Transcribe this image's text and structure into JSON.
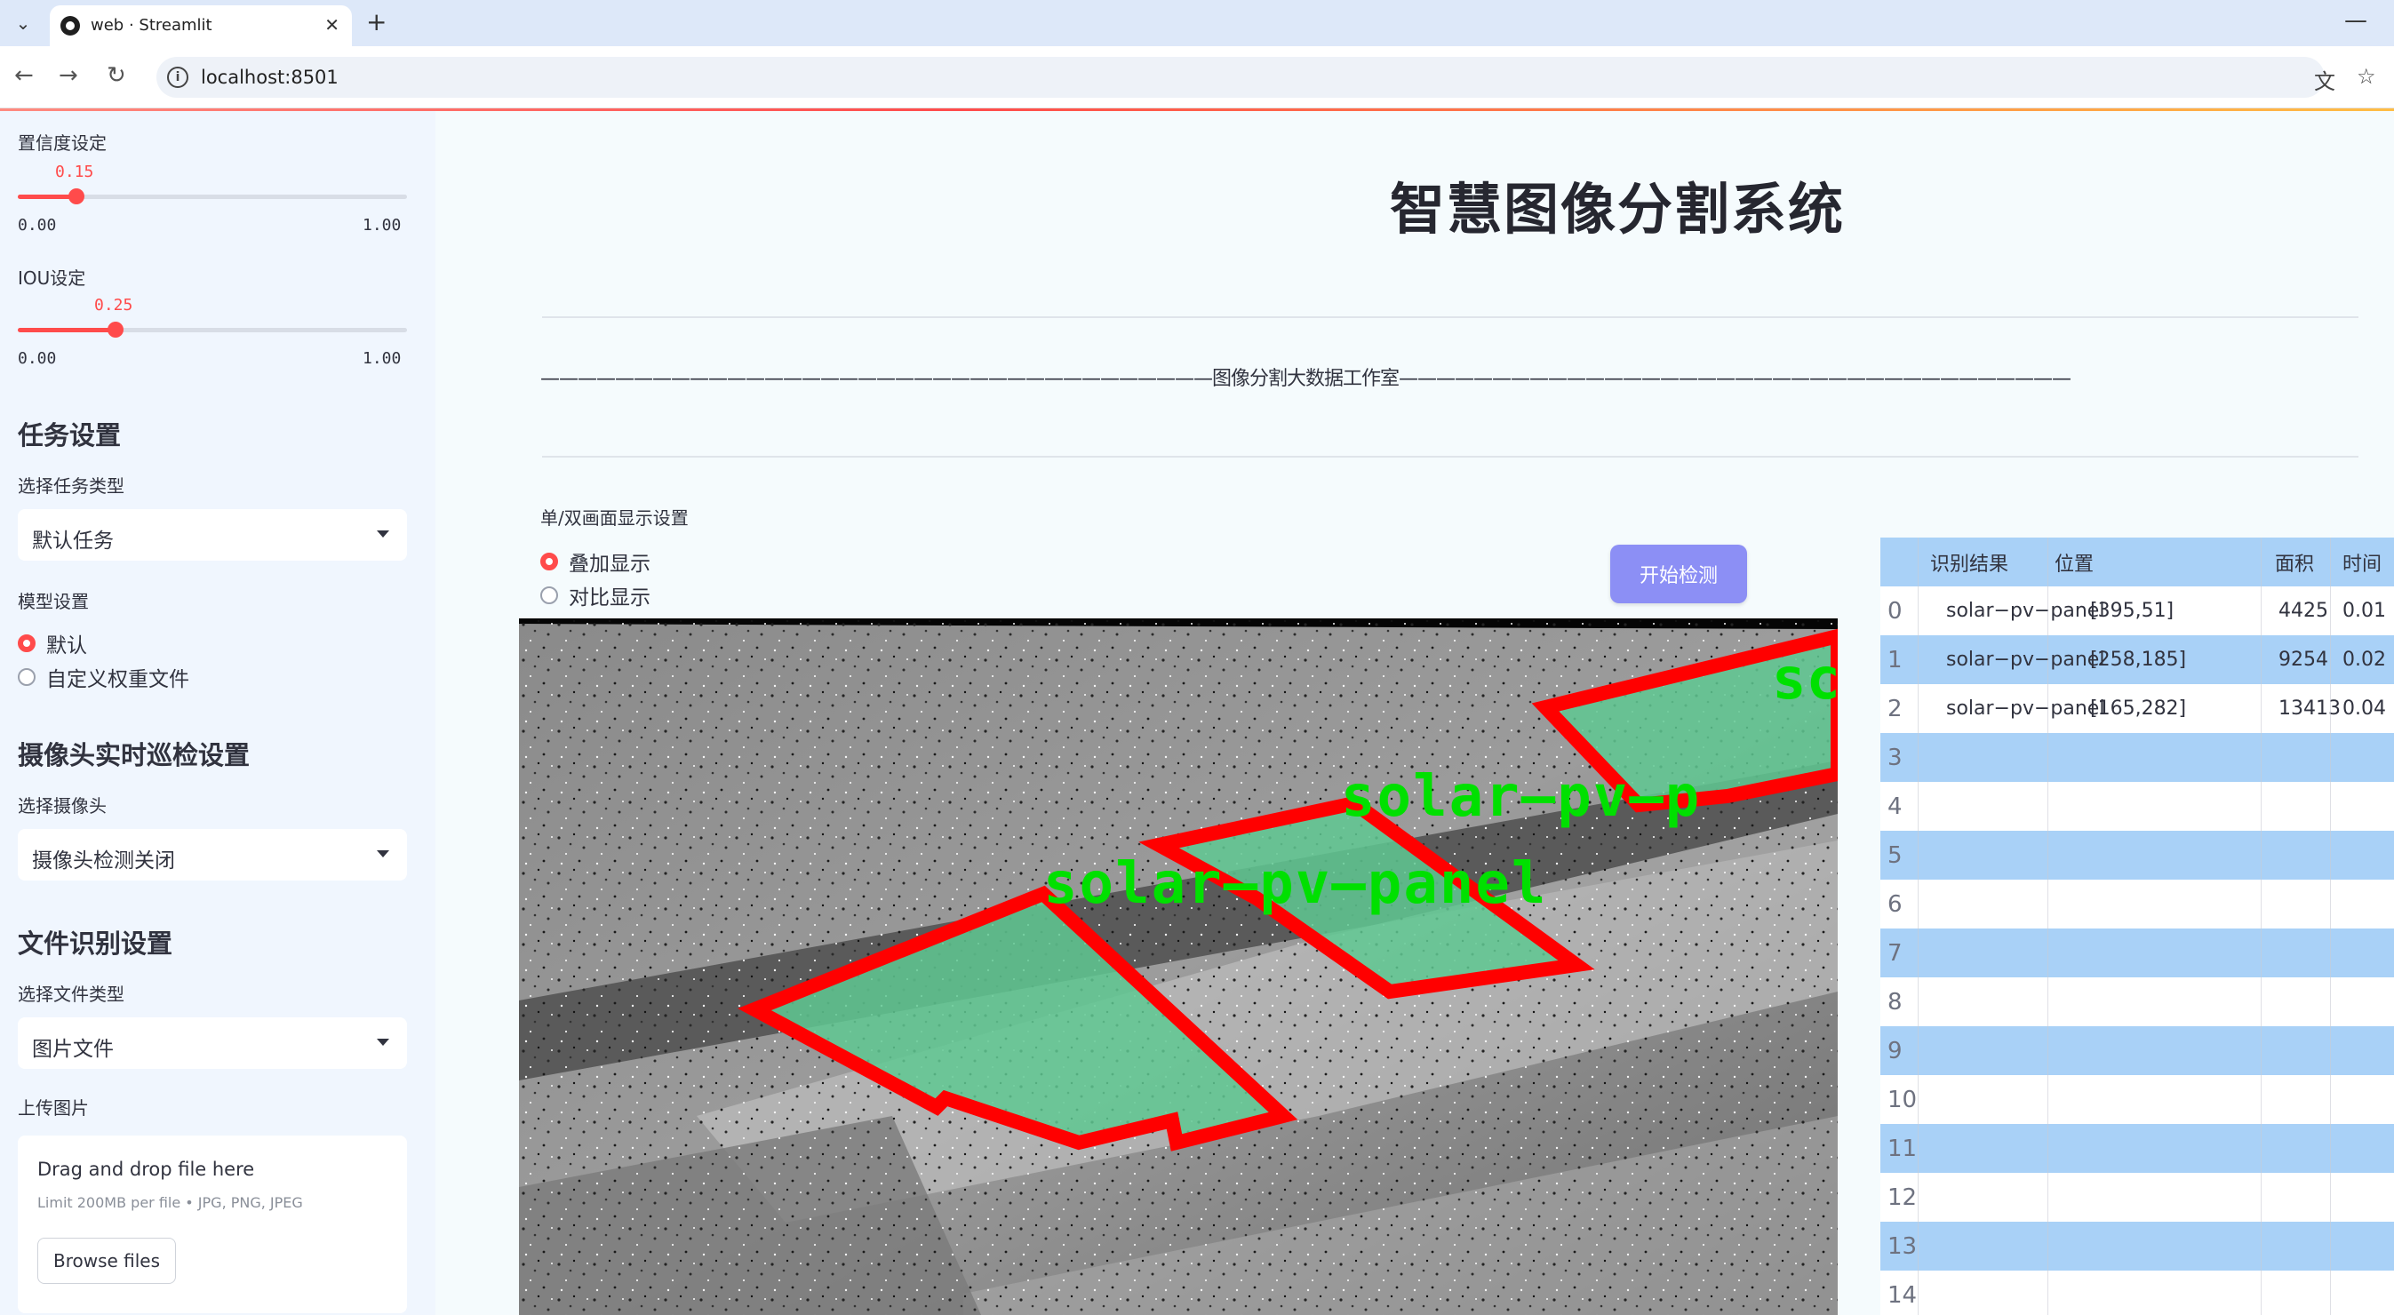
{
  "browser": {
    "tab_title": "web · Streamlit",
    "url": "localhost:8501"
  },
  "sidebar": {
    "confidence": {
      "label": "置信度设定",
      "value": 0.15,
      "value_text": "0.15",
      "min": "0.00",
      "max": "1.00"
    },
    "iou": {
      "label": "IOU设定",
      "value": 0.25,
      "value_text": "0.25",
      "min": "0.00",
      "max": "1.00"
    },
    "task": {
      "header": "任务设置",
      "label": "选择任务类型",
      "selected": "默认任务"
    },
    "model": {
      "label": "模型设置",
      "options": [
        "默认",
        "自定义权重文件"
      ],
      "selected_index": 0
    },
    "camera": {
      "header": "摄像头实时巡检设置",
      "label": "选择摄像头",
      "selected": "摄像头检测关闭"
    },
    "file": {
      "header": "文件识别设置",
      "label": "选择文件类型",
      "selected": "图片文件"
    },
    "upload": {
      "label": "上传图片",
      "drag_text": "Drag and drop file here",
      "limit_text": "Limit 200MB per file • JPG, PNG, JPEG",
      "browse_label": "Browse files"
    }
  },
  "main": {
    "title": "智慧图像分割系统",
    "banner": "————————————————————————————————————图像分割大数据工作室————————————————————————————————————",
    "display_mode": {
      "label": "单/双画面显示设置",
      "options": [
        "叠加显示",
        "对比显示"
      ],
      "selected_index": 0
    },
    "detect_button": "开始检测",
    "image_labels": [
      "solar—pv—p",
      "solar—pv—panel",
      "sc"
    ]
  },
  "results": {
    "columns": [
      "识别结果",
      "位置",
      "面积",
      "时间"
    ],
    "rows": [
      {
        "index": "0",
        "result": "solar−pv−panel",
        "position": "[395,51]",
        "area": "4425",
        "time": "0.01"
      },
      {
        "index": "1",
        "result": "solar−pv−panel",
        "position": "[258,185]",
        "area": "9254",
        "time": "0.02"
      },
      {
        "index": "2",
        "result": "solar−pv−panel",
        "position": "[165,282]",
        "area": "13413",
        "time": "0.04"
      },
      {
        "index": "3",
        "result": "",
        "position": "",
        "area": "",
        "time": ""
      },
      {
        "index": "4",
        "result": "",
        "position": "",
        "area": "",
        "time": ""
      },
      {
        "index": "5",
        "result": "",
        "position": "",
        "area": "",
        "time": ""
      },
      {
        "index": "6",
        "result": "",
        "position": "",
        "area": "",
        "time": ""
      },
      {
        "index": "7",
        "result": "",
        "position": "",
        "area": "",
        "time": ""
      },
      {
        "index": "8",
        "result": "",
        "position": "",
        "area": "",
        "time": ""
      },
      {
        "index": "9",
        "result": "",
        "position": "",
        "area": "",
        "time": ""
      },
      {
        "index": "10",
        "result": "",
        "position": "",
        "area": "",
        "time": ""
      },
      {
        "index": "11",
        "result": "",
        "position": "",
        "area": "",
        "time": ""
      },
      {
        "index": "12",
        "result": "",
        "position": "",
        "area": "",
        "time": ""
      },
      {
        "index": "13",
        "result": "",
        "position": "",
        "area": "",
        "time": ""
      },
      {
        "index": "14",
        "result": "",
        "position": "",
        "area": "",
        "time": ""
      }
    ]
  },
  "colors": {
    "accent": "#ff4b4b",
    "button": "#8c8ff5",
    "table_stripe": "#a9d1f7",
    "sidebar_bg": "#f0f6fe",
    "mask_fill": "#5fc892",
    "mask_outline": "#ff0000",
    "mask_label": "#00e000"
  }
}
